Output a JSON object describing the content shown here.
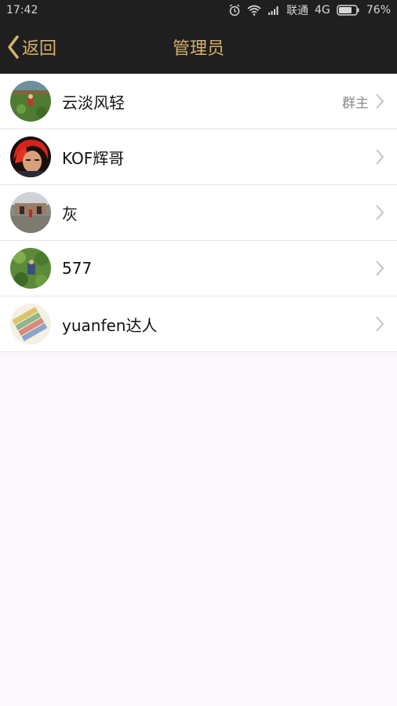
{
  "status": {
    "time": "17:42",
    "carrier": "联通",
    "network": "4G",
    "battery": "76%",
    "battery_level": 0.76
  },
  "nav": {
    "back_label": "返回",
    "title": "管理员",
    "accent_color": "#d6b16a"
  },
  "members": [
    {
      "name": "云淡风轻",
      "tag": "群主",
      "avatar": "green-field-avatar"
    },
    {
      "name": "KOF辉哥",
      "tag": "",
      "avatar": "red-hair-character-avatar"
    },
    {
      "name": "灰",
      "tag": "",
      "avatar": "courtyard-photo-avatar"
    },
    {
      "name": "577",
      "tag": "",
      "avatar": "green-game-scene-avatar"
    },
    {
      "name": "yuanfen达人",
      "tag": "",
      "avatar": "banknotes-avatar"
    }
  ]
}
